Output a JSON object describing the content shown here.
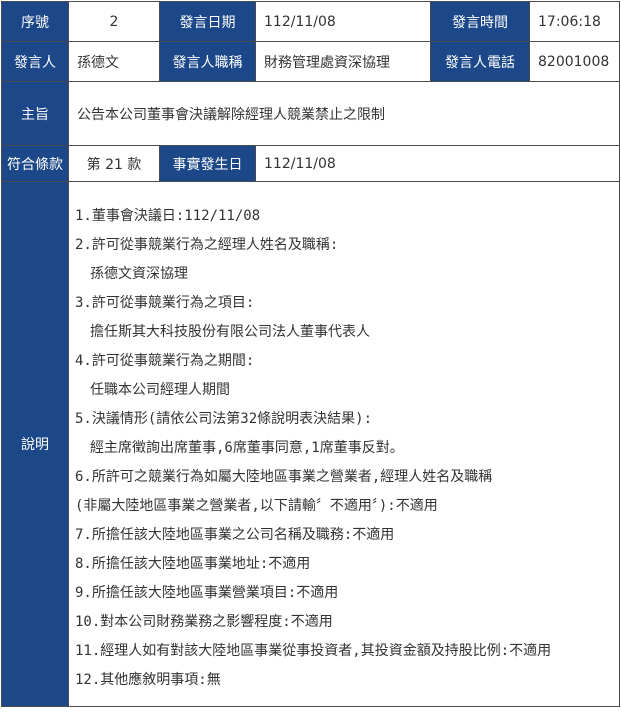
{
  "header": {
    "seq_label": "序號",
    "seq_value": "2",
    "date_label": "發言日期",
    "date_value": "112/11/08",
    "time_label": "發言時間",
    "time_value": "17:06:18"
  },
  "speaker": {
    "name_label": "發言人",
    "name_value": "孫德文",
    "title_label": "發言人職稱",
    "title_value": "財務管理處資深協理",
    "phone_label": "發言人電話",
    "phone_value": "82001008"
  },
  "subject": {
    "label": "主旨",
    "value": "公告本公司董事會決議解除經理人競業禁止之限制"
  },
  "clause": {
    "label": "符合條款",
    "value": "第 21 款",
    "event_date_label": "事實發生日",
    "event_date_value": "112/11/08"
  },
  "description": {
    "label": "說明",
    "lines": [
      "1.董事會決議日:112/11/08",
      "2.許可從事競業行為之經理人姓名及職稱:",
      "孫德文資深協理",
      "3.許可從事競業行為之項目:",
      "擔任斯其大科技股份有限公司法人董事代表人",
      "4.許可從事競業行為之期間:",
      "任職本公司經理人期間",
      "5.決議情形(請依公司法第32條說明表決結果):",
      "經主席徵詢出席董事,6席董事同意,1席董事反對。",
      "6.所許可之競業行為如屬大陸地區事業之營業者,經理人姓名及職稱",
      "(非屬大陸地區事業之營業者,以下請輸〞不適用〞):不適用",
      "7.所擔任該大陸地區事業之公司名稱及職務:不適用",
      "8.所擔任該大陸地區事業地址:不適用",
      "9.所擔任該大陸地區事業營業項目:不適用",
      "10.對本公司財務業務之影響程度:不適用",
      "11.經理人如有對該大陸地區事業從事投資者,其投資金額及持股比例:不適用",
      "12.其他應敘明事項:無"
    ]
  },
  "colors": {
    "header_bg": "#1c4788",
    "header_text": "#ffffff",
    "border": "#4a4a4a"
  }
}
